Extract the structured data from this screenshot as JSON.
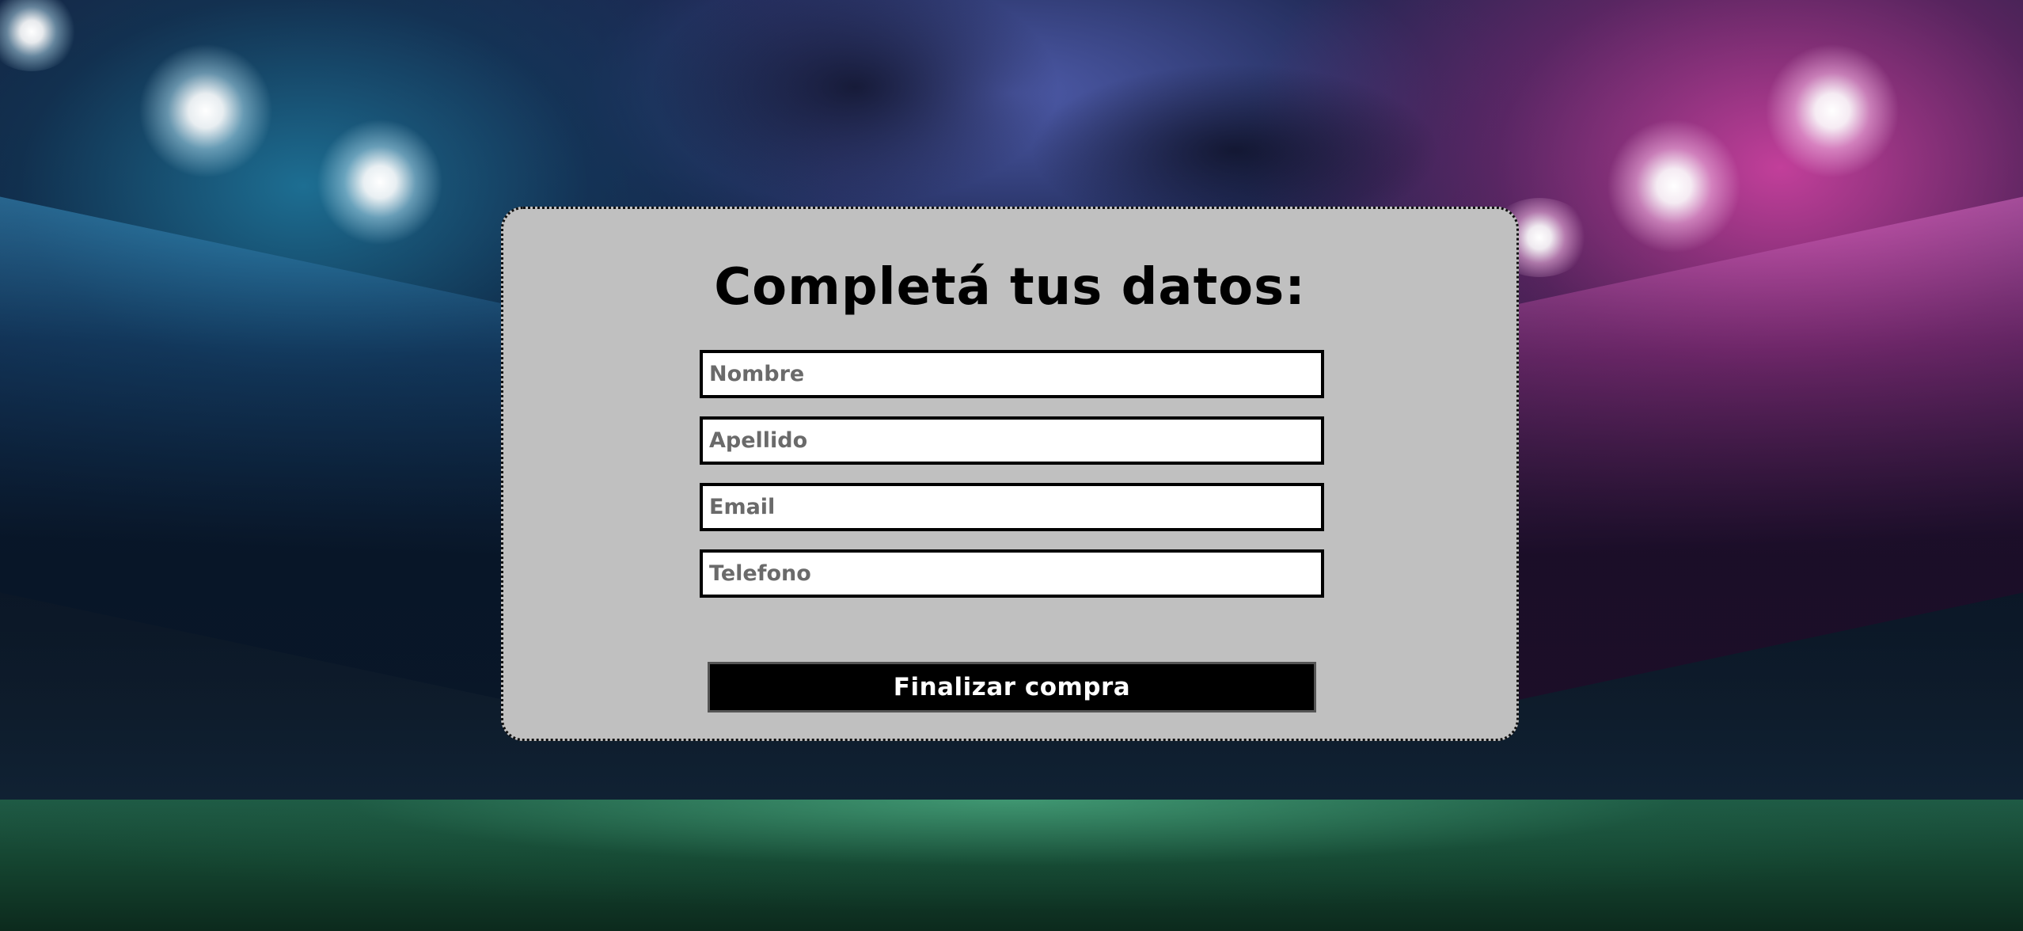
{
  "form": {
    "title": "Completá tus datos:",
    "fields": {
      "nombre": {
        "placeholder": "Nombre",
        "value": ""
      },
      "apellido": {
        "placeholder": "Apellido",
        "value": ""
      },
      "email": {
        "placeholder": "Email",
        "value": ""
      },
      "telefono": {
        "placeholder": "Telefono",
        "value": ""
      }
    },
    "submit_label": "Finalizar compra"
  },
  "colors": {
    "card_background": "#c0c0c0",
    "button_background": "#000000",
    "button_text": "#ffffff"
  }
}
